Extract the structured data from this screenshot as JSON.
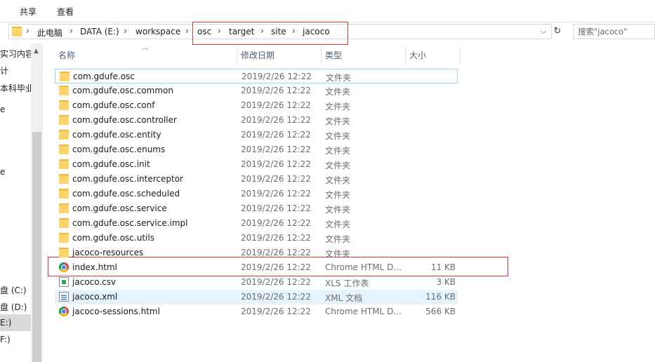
{
  "ribbon": {
    "tabs": [
      "共享",
      "查看"
    ]
  },
  "address": {
    "crumbs": [
      "此电脑",
      "DATA (E:)",
      "workspace",
      "osc",
      "target",
      "site",
      "jacoco"
    ],
    "separator": "›"
  },
  "search": {
    "placeholder": "搜索\"jacoco\""
  },
  "nav": {
    "items": [
      "实习内容",
      "计",
      "本科毕业论",
      "e",
      "e",
      "盘 (C:)",
      "盘 (D:)",
      "E:)",
      "F:)"
    ]
  },
  "columns": {
    "name": "名称",
    "date": "修改日期",
    "type": "类型",
    "size": "大小"
  },
  "files": [
    {
      "name": "com.gdufe.osc",
      "date": "2019/2/26 12:22",
      "type": "文件夹",
      "size": "",
      "icon": "folder-icon"
    },
    {
      "name": "com.gdufe.osc.common",
      "date": "2019/2/26 12:22",
      "type": "文件夹",
      "size": "",
      "icon": "folder-icon"
    },
    {
      "name": "com.gdufe.osc.conf",
      "date": "2019/2/26 12:22",
      "type": "文件夹",
      "size": "",
      "icon": "folder-icon"
    },
    {
      "name": "com.gdufe.osc.controller",
      "date": "2019/2/26 12:22",
      "type": "文件夹",
      "size": "",
      "icon": "folder-icon"
    },
    {
      "name": "com.gdufe.osc.entity",
      "date": "2019/2/26 12:22",
      "type": "文件夹",
      "size": "",
      "icon": "folder-icon"
    },
    {
      "name": "com.gdufe.osc.enums",
      "date": "2019/2/26 12:22",
      "type": "文件夹",
      "size": "",
      "icon": "folder-icon"
    },
    {
      "name": "com.gdufe.osc.init",
      "date": "2019/2/26 12:22",
      "type": "文件夹",
      "size": "",
      "icon": "folder-icon"
    },
    {
      "name": "com.gdufe.osc.interceptor",
      "date": "2019/2/26 12:22",
      "type": "文件夹",
      "size": "",
      "icon": "folder-icon"
    },
    {
      "name": "com.gdufe.osc.scheduled",
      "date": "2019/2/26 12:22",
      "type": "文件夹",
      "size": "",
      "icon": "folder-icon"
    },
    {
      "name": "com.gdufe.osc.service",
      "date": "2019/2/26 12:22",
      "type": "文件夹",
      "size": "",
      "icon": "folder-icon"
    },
    {
      "name": "com.gdufe.osc.service.impl",
      "date": "2019/2/26 12:22",
      "type": "文件夹",
      "size": "",
      "icon": "folder-icon"
    },
    {
      "name": "com.gdufe.osc.utils",
      "date": "2019/2/26 12:22",
      "type": "文件夹",
      "size": "",
      "icon": "folder-icon"
    },
    {
      "name": "jacoco-resources",
      "date": "2019/2/26 12:22",
      "type": "文件夹",
      "size": "",
      "icon": "folder-icon"
    },
    {
      "name": "index.html",
      "date": "2019/2/26 12:22",
      "type": "Chrome HTML D...",
      "size": "11 KB",
      "icon": "chrome-html-icon"
    },
    {
      "name": "jacoco.csv",
      "date": "2019/2/26 12:22",
      "type": "XLS 工作表",
      "size": "3 KB",
      "icon": "csv-file-icon"
    },
    {
      "name": "jacoco.xml",
      "date": "2019/2/26 12:22",
      "type": "XML 文档",
      "size": "116 KB",
      "icon": "xml-file-icon"
    },
    {
      "name": "jacoco-sessions.html",
      "date": "2019/2/26 12:22",
      "type": "Chrome HTML D...",
      "size": "566 KB",
      "icon": "chrome-html-icon"
    }
  ],
  "colors": {
    "highlight": "#d9373f",
    "selection_border": "#99d1ff",
    "hover": "#e5f3ff"
  }
}
